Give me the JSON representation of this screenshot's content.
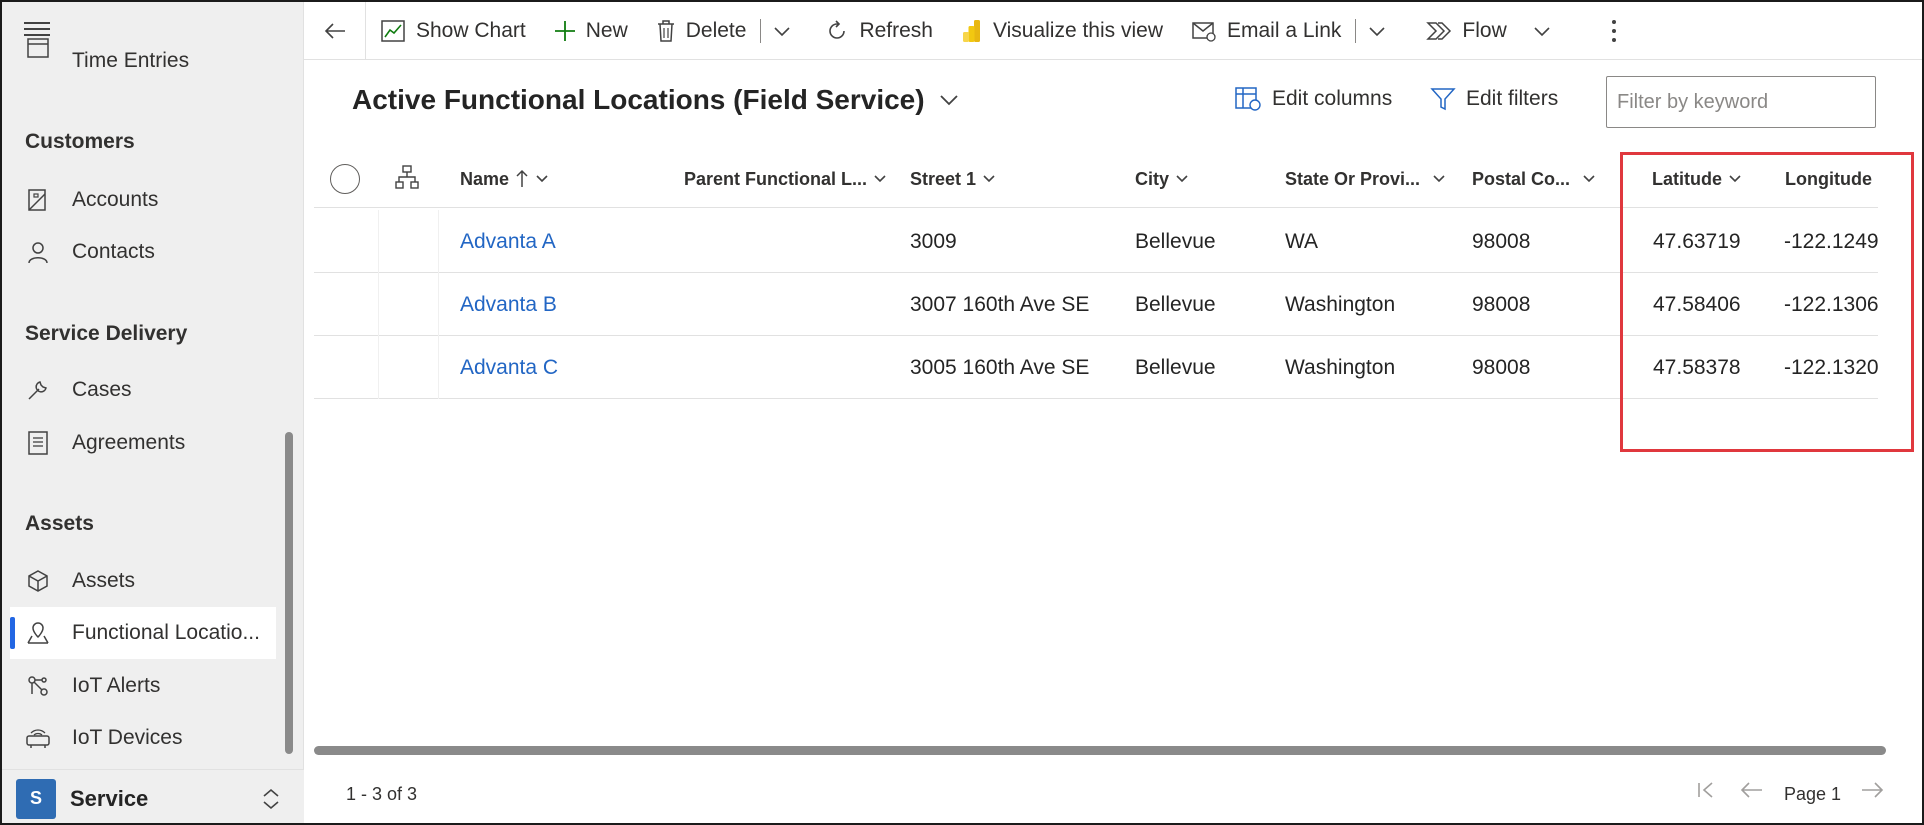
{
  "sidebar": {
    "top_partial_item": "Time Entries",
    "groups": [
      {
        "title": "Customers",
        "items": [
          {
            "label": "Accounts",
            "icon": "accounts-icon"
          },
          {
            "label": "Contacts",
            "icon": "person-icon"
          }
        ]
      },
      {
        "title": "Service Delivery",
        "items": [
          {
            "label": "Cases",
            "icon": "wrench-icon"
          },
          {
            "label": "Agreements",
            "icon": "document-icon"
          }
        ]
      },
      {
        "title": "Assets",
        "items": [
          {
            "label": "Assets",
            "icon": "cube-icon"
          },
          {
            "label": "Functional Locatio...",
            "icon": "map-pin-icon",
            "active": true
          },
          {
            "label": "IoT Alerts",
            "icon": "iot-alert-icon"
          },
          {
            "label": "IoT Devices",
            "icon": "iot-device-icon"
          }
        ]
      }
    ],
    "area": {
      "badge": "S",
      "name": "Service"
    }
  },
  "commands": {
    "show_chart": "Show Chart",
    "new": "New",
    "delete": "Delete",
    "refresh": "Refresh",
    "visualize": "Visualize this view",
    "email_link": "Email a Link",
    "flow": "Flow"
  },
  "view": {
    "title": "Active Functional Locations (Field Service)",
    "edit_columns": "Edit columns",
    "edit_filters": "Edit filters",
    "filter_placeholder": "Filter by keyword"
  },
  "grid": {
    "columns": [
      "Name",
      "Parent Functional L...",
      "Street 1",
      "City",
      "State Or Provi...",
      "Postal Co...",
      "Latitude",
      "Longitude"
    ],
    "sort": "ascending",
    "rows": [
      {
        "name": "Advanta A",
        "parent": "",
        "street": "3009",
        "city": "Bellevue",
        "state": "WA",
        "postal": "98008",
        "lat": "47.63719",
        "lon": "-122.1249"
      },
      {
        "name": "Advanta B",
        "parent": "",
        "street": "3007 160th Ave SE",
        "city": "Bellevue",
        "state": "Washington",
        "postal": "98008",
        "lat": "47.58406",
        "lon": "-122.1306"
      },
      {
        "name": "Advanta C",
        "parent": "",
        "street": "3005 160th Ave SE",
        "city": "Bellevue",
        "state": "Washington",
        "postal": "98008",
        "lat": "47.58378",
        "lon": "-122.1320"
      }
    ]
  },
  "footer": {
    "count": "1 - 3 of 3",
    "page": "Page 1"
  },
  "colors": {
    "accent": "#2266e3",
    "link": "#2266c4",
    "highlight": "#e0383e",
    "area_badge": "#2f6cb3"
  }
}
